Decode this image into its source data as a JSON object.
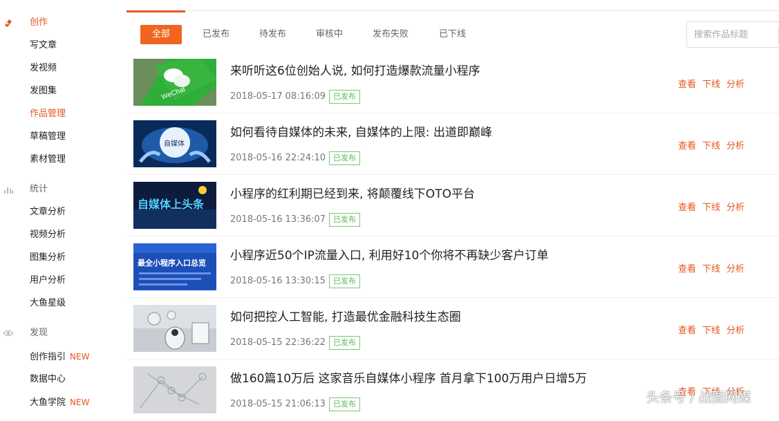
{
  "sidebar": {
    "sections": [
      {
        "label": "创作",
        "icon": "pen-icon",
        "items": [
          {
            "label": "写文章"
          },
          {
            "label": "发视频"
          },
          {
            "label": "发图集"
          },
          {
            "label": "作品管理",
            "active": true
          },
          {
            "label": "草稿管理"
          },
          {
            "label": "素材管理"
          }
        ]
      },
      {
        "label": "统计",
        "icon": "bar-chart-icon",
        "items": [
          {
            "label": "文章分析"
          },
          {
            "label": "视频分析"
          },
          {
            "label": "图集分析"
          },
          {
            "label": "用户分析"
          },
          {
            "label": "大鱼星级"
          }
        ]
      },
      {
        "label": "发现",
        "icon": "eye-icon",
        "items": [
          {
            "label": "创作指引",
            "badge": "NEW"
          },
          {
            "label": "数据中心"
          },
          {
            "label": "大鱼学院",
            "badge": "NEW"
          }
        ]
      }
    ]
  },
  "filters": [
    "全部",
    "已发布",
    "待发布",
    "审核中",
    "发布失败",
    "已下线"
  ],
  "search": {
    "placeholder": "搜索作品标题"
  },
  "articles": [
    {
      "title": "来听听这6位创始人说, 如何打造爆款流量小程序",
      "date": "2018-05-17 08:16:09",
      "status": "已发布",
      "thumb": "wechat"
    },
    {
      "title": "如何看待自媒体的未来, 自媒体的上限: 出道即巅峰",
      "date": "2018-05-16 22:24:10",
      "status": "已发布",
      "thumb": "globe",
      "thumb_text": "自媒体"
    },
    {
      "title": "小程序的红利期已经到来, 将颠覆线下OTO平台",
      "date": "2018-05-16 13:36:07",
      "status": "已发布",
      "thumb": "banner",
      "thumb_text": "自媒体上头条"
    },
    {
      "title": "小程序近50个IP流量入口, 利用好10个你将不再缺少客户订单",
      "date": "2018-05-16 13:30:15",
      "status": "已发布",
      "thumb": "blue",
      "thumb_text": "最全小程序入口总览"
    },
    {
      "title": "如何把控人工智能, 打造最优金融科技生态圈",
      "date": "2018-05-15 22:36:22",
      "status": "已发布",
      "thumb": "robot"
    },
    {
      "title": "做160篇10万后 这家音乐自媒体小程序 首月拿下100万用户日增5万",
      "date": "2018-05-15 21:06:13",
      "status": "已发布",
      "thumb": "network"
    }
  ],
  "actions": [
    "查看",
    "下线",
    "分析"
  ],
  "watermark": "头条号 / 战图网媒",
  "colors": {
    "accent": "#e8541e",
    "published": "#5cb85c"
  }
}
